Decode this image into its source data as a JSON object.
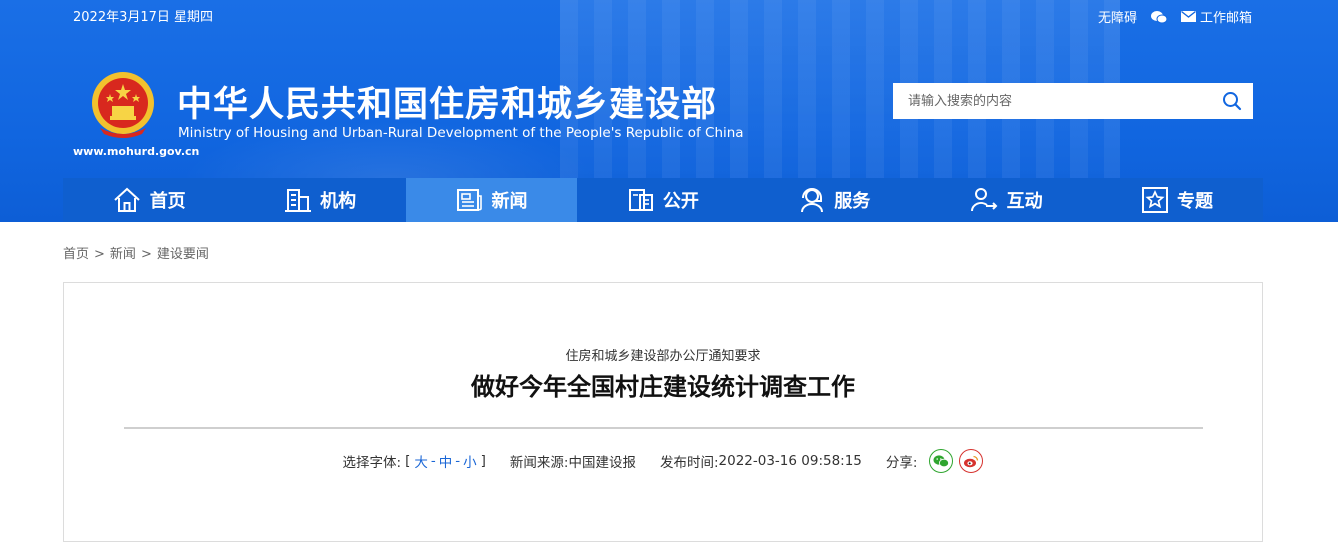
{
  "header": {
    "date": "2022年3月17日 星期四",
    "top_links": {
      "accessible": "无障碍",
      "wechat_icon": "wechat-icon",
      "mail": "工作邮箱"
    },
    "site_url": "www.mohurd.gov.cn",
    "title": "中华人民共和国住房和城乡建设部",
    "subtitle": "Ministry of Housing and Urban-Rural Development of the People's Republic of China",
    "search": {
      "placeholder": "请输入搜索的内容"
    },
    "colors": {
      "primary": "#1166e0",
      "nav": "#0f5fcf",
      "nav_active": "#3a8ae8"
    }
  },
  "nav": {
    "items": [
      {
        "label": "首页",
        "icon": "home-icon"
      },
      {
        "label": "机构",
        "icon": "building-icon"
      },
      {
        "label": "新闻",
        "icon": "news-icon",
        "active": true
      },
      {
        "label": "公开",
        "icon": "document-icon"
      },
      {
        "label": "服务",
        "icon": "service-icon"
      },
      {
        "label": "互动",
        "icon": "interaction-icon"
      },
      {
        "label": "专题",
        "icon": "star-icon"
      }
    ]
  },
  "breadcrumb": {
    "items": [
      "首页",
      "新闻",
      "建设要闻"
    ],
    "sep": ">"
  },
  "article": {
    "kicker": "住房和城乡建设部办公厅通知要求",
    "title": "做好今年全国村庄建设统计调查工作",
    "font_label": "选择字体:",
    "font_open": "[",
    "font_large": "大",
    "font_medium": "中",
    "font_small": "小",
    "font_dash": "-",
    "font_close": "]",
    "source_label": "新闻来源:",
    "source": "中国建设报",
    "time_label": "发布时间:",
    "time": "2022-03-16 09:58:15",
    "share_label": "分享:"
  }
}
